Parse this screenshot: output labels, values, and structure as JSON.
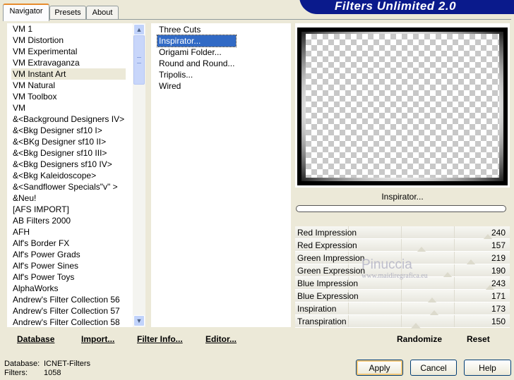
{
  "tabs": [
    "Navigator",
    "Presets",
    "About"
  ],
  "app_title": "Filters Unlimited 2.0",
  "filter_categories": [
    "VM 1",
    "VM Distortion",
    "VM Experimental",
    "VM Extravaganza",
    "VM Instant Art",
    "VM Natural",
    "VM Toolbox",
    "VM",
    "&<Background Designers IV>",
    "&<Bkg Designer sf10 I>",
    "&<BKg Designer sf10 II>",
    "&<Bkg Designer sf10 III>",
    "&<Bkg Designers sf10 IV>",
    "&<Bkg Kaleidoscope>",
    "&<Sandflower Specials\"v\" >",
    "&Neu!",
    "[AFS IMPORT]",
    "AB Filters 2000",
    "AFH",
    "Alf's Border FX",
    "Alf's Power Grads",
    "Alf's Power Sines",
    "Alf's Power Toys",
    "AlphaWorks",
    "Andrew's Filter Collection 56",
    "Andrew's Filter Collection 57",
    "Andrew's Filter Collection 58"
  ],
  "selected_category": "VM Instant Art",
  "effects": [
    "Three Cuts",
    "Inspirator...",
    "Origami Folder...",
    "Round and Round...",
    "Tripolis...",
    "Wired"
  ],
  "selected_effect": "Inspirator...",
  "left_buttons": {
    "database": "Database",
    "import": "Import...",
    "filter_info": "Filter Info...",
    "editor": "Editor..."
  },
  "preview_label": "Inspirator...",
  "sliders": [
    {
      "label": "Red Impression",
      "value": 240
    },
    {
      "label": "Red Expression",
      "value": 157
    },
    {
      "label": "Green Impression",
      "value": 219
    },
    {
      "label": "Green Expression",
      "value": 190
    },
    {
      "label": "Blue Impression",
      "value": 243
    },
    {
      "label": "Blue Expression",
      "value": 171
    },
    {
      "label": "Inspiration",
      "value": 173
    },
    {
      "label": "Transpiration",
      "value": 150
    }
  ],
  "randomize_label": "Randomize",
  "reset_label": "Reset",
  "status": {
    "database_label": "Database:",
    "database_value": "ICNET-Filters",
    "filters_label": "Filters:",
    "filters_value": "1058"
  },
  "buttons": {
    "apply": "Apply",
    "cancel": "Cancel",
    "help": "Help"
  },
  "watermark": {
    "line1": "Pinuccia",
    "line2": "www.maidiregrafica.eu"
  },
  "scroll_icons": {
    "up": "▲",
    "down": "▼"
  }
}
